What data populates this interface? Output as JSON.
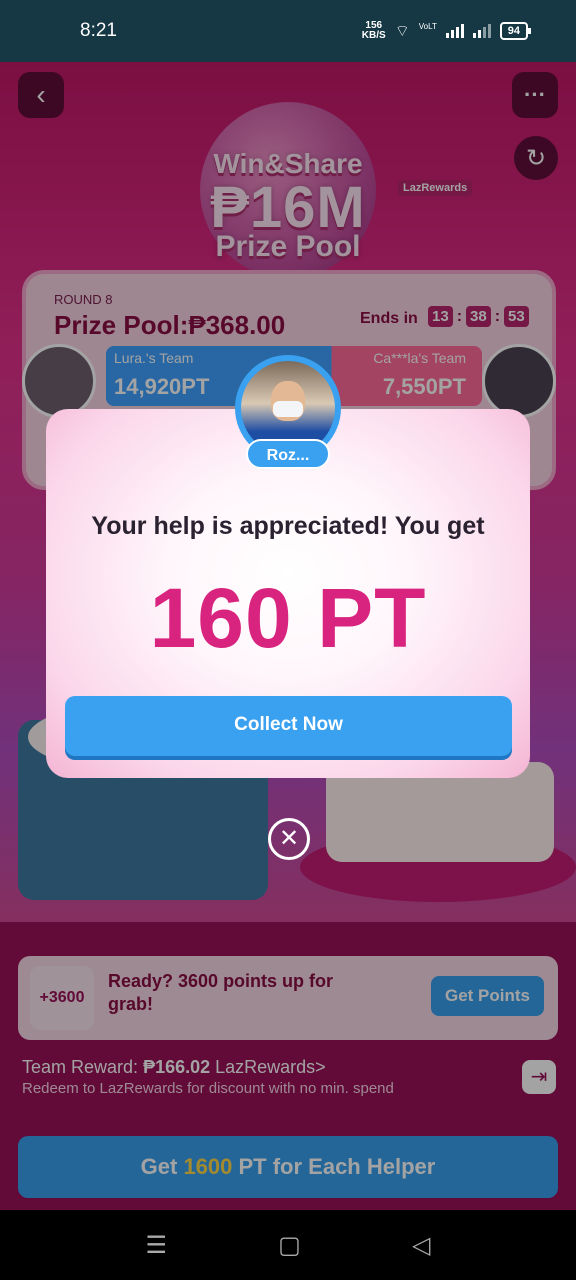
{
  "status_bar": {
    "time": "8:21",
    "net_speed_value": "156",
    "net_speed_unit": "KB/S",
    "volte": "VoLTE",
    "battery": "94"
  },
  "header": {
    "win_share": "Win&Share",
    "prize_amount": "₱16M",
    "prize_pool_label": "Prize Pool",
    "laz_rewards_tag": "LazRewards"
  },
  "board": {
    "round": "ROUND 8",
    "prize_pool": "Prize Pool:₱368.00",
    "ends_in_label": "Ends in",
    "timer": {
      "hours": "13",
      "minutes": "38",
      "seconds": "53"
    },
    "team_left": {
      "name": "Lura.'s Team",
      "points": "14,920PT"
    },
    "team_right": {
      "name": "Ca***la's Team",
      "points": "7,550PT"
    }
  },
  "reward_card": {
    "badge": "+3600",
    "text": "Ready? 3600 points up for grab!",
    "button": "Get Points"
  },
  "team_reward": {
    "label": "Team Reward:",
    "amount": "₱166.02",
    "link": "LazRewards>",
    "subtitle": "Redeem to LazRewards for discount with no min. spend"
  },
  "cta": {
    "prefix": "Get ",
    "points": "1600",
    "suffix": " PT for Each Helper"
  },
  "modal": {
    "helper_name": "Roz...",
    "message": "Your help is appreciated! You get",
    "points": "160 PT",
    "collect_button": "Collect Now"
  },
  "icons": {
    "back": "chevron-left-icon",
    "more": "more-horizontal-icon",
    "refresh": "refresh-icon",
    "close": "close-circle-icon",
    "exit": "exit-icon"
  },
  "colors": {
    "primary_pink": "#d8247e",
    "button_blue": "#3aa0f0",
    "highlight_yellow": "#ffd84a"
  }
}
